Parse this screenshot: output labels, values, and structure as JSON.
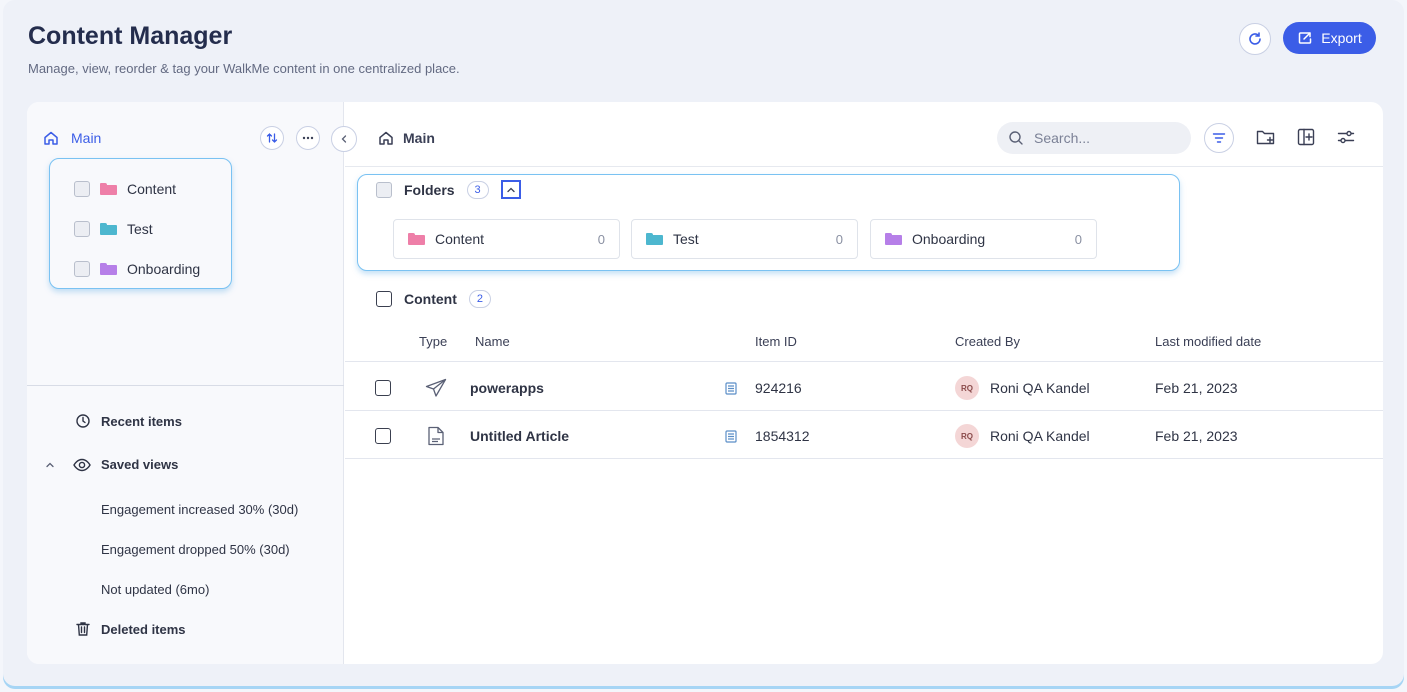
{
  "header": {
    "title": "Content Manager",
    "subtitle": "Manage, view, reorder & tag your WalkMe content in one centralized place.",
    "export_label": "Export"
  },
  "colors": {
    "accent": "#3b5de7",
    "folder_content": "#ee7fa8",
    "folder_test": "#4db7cf",
    "folder_onboarding": "#b67fe8"
  },
  "sidebar": {
    "home_label": "Main",
    "folders": [
      {
        "label": "Content",
        "color": "#ee7fa8"
      },
      {
        "label": "Test",
        "color": "#4db7cf"
      },
      {
        "label": "Onboarding",
        "color": "#b67fe8"
      }
    ],
    "recent_label": "Recent items",
    "saved_views_label": "Saved views",
    "saved_views": [
      "Engagement increased 30% (30d)",
      "Engagement dropped 50% (30d)",
      "Not updated (6mo)"
    ],
    "deleted_label": "Deleted items"
  },
  "main": {
    "breadcrumb": "Main",
    "search_placeholder": "Search...",
    "folders_section": {
      "label": "Folders",
      "count": "3",
      "items": [
        {
          "label": "Content",
          "count": "0",
          "color": "#ee7fa8"
        },
        {
          "label": "Test",
          "count": "0",
          "color": "#4db7cf"
        },
        {
          "label": "Onboarding",
          "count": "0",
          "color": "#b67fe8"
        }
      ]
    },
    "content_section": {
      "label": "Content",
      "count": "2"
    },
    "table": {
      "columns": [
        "Type",
        "Name",
        "Item ID",
        "Created By",
        "Last modified date"
      ],
      "rows": [
        {
          "type_icon": "paper-plane-icon",
          "name": "powerapps",
          "item_id": "924216",
          "initials": "RQ",
          "created_by": "Roni QA Kandel",
          "modified": "Feb 21, 2023"
        },
        {
          "type_icon": "article-icon",
          "name": "Untitled Article",
          "item_id": "1854312",
          "initials": "RQ",
          "created_by": "Roni QA Kandel",
          "modified": "Feb 21, 2023"
        }
      ]
    }
  }
}
